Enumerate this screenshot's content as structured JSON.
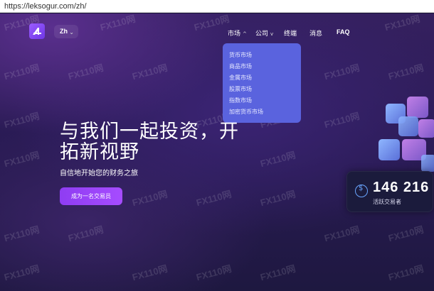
{
  "browser": {
    "url": "https://leksogur.com/zh/"
  },
  "header": {
    "lang_label": "Zh",
    "nav": [
      {
        "label": "市场",
        "has_chevron": true,
        "chevron": "^"
      },
      {
        "label": "公司",
        "has_chevron": true,
        "chevron": "v"
      },
      {
        "label": "终端"
      },
      {
        "label": "消息"
      },
      {
        "label": "FAQ"
      }
    ]
  },
  "market_dropdown": [
    "货币市场",
    "商品市场",
    "金属市场",
    "股票市场",
    "指数市场",
    "加密货币市场"
  ],
  "hero": {
    "title": "与我们一起投资，开拓新视野",
    "subtitle": "自信地开始您的财务之旅",
    "cta_label": "成为一名交易员"
  },
  "stat": {
    "value": "146 216",
    "label": "活跃交易者"
  },
  "watermark": "FX110网",
  "colors": {
    "accent": "#9b5cff",
    "dropdown_bg": "#5a63de",
    "card_bg": "#1b1b3c"
  }
}
